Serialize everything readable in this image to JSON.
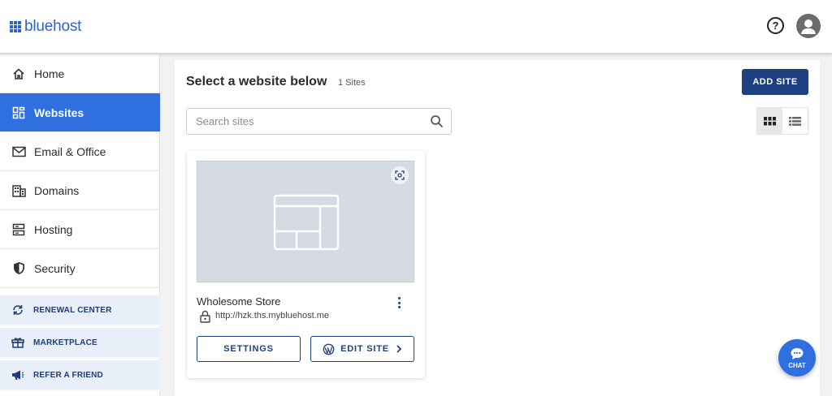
{
  "header": {
    "logo_text": "bluehost",
    "help_label": "?",
    "icons": {
      "logo": "grid-logo-icon",
      "help": "question-circle-icon",
      "account": "user-avatar-icon"
    }
  },
  "sidebar": {
    "items": [
      {
        "label": "Home",
        "icon": "home-icon",
        "active": false
      },
      {
        "label": "Websites",
        "icon": "websites-icon",
        "active": true
      },
      {
        "label": "Email & Office",
        "icon": "envelope-icon",
        "active": false
      },
      {
        "label": "Domains",
        "icon": "building-icon",
        "active": false
      },
      {
        "label": "Hosting",
        "icon": "server-icon",
        "active": false
      },
      {
        "label": "Security",
        "icon": "shield-icon",
        "active": false
      }
    ],
    "sub_items": [
      {
        "label": "RENEWAL CENTER",
        "icon": "refresh-icon"
      },
      {
        "label": "MARKETPLACE",
        "icon": "gift-icon"
      },
      {
        "label": "REFER A FRIEND",
        "icon": "megaphone-icon"
      }
    ]
  },
  "main": {
    "title": "Select a website below",
    "site_count": "1 Sites",
    "add_site_label": "ADD SITE",
    "search": {
      "placeholder": "Search sites",
      "value": ""
    },
    "view_mode": "grid"
  },
  "sites": [
    {
      "name": "Wholesome Store",
      "url": "http://hzk.ths.mybluehost.me",
      "settings_label": "SETTINGS",
      "edit_label": "EDIT SITE"
    }
  ],
  "chat": {
    "label": "CHAT"
  },
  "colors": {
    "brand": "#2f63c8",
    "active_nav": "#2f6fe0",
    "primary_button": "#1e3f80",
    "sub_nav_bg": "#e9eff9"
  }
}
